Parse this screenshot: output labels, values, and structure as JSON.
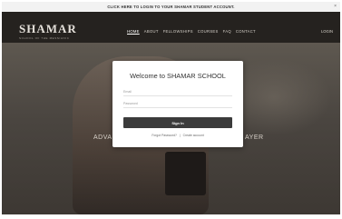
{
  "announcement": {
    "text": "CLICK HERE TO LOGIN TO YOUR SHAMAR STUDENT ACCOUNT.",
    "close": "×"
  },
  "header": {
    "logo": "SHAMAR",
    "tagline": "SCHOOL OF THE MESSIANIC",
    "nav": [
      "HOME",
      "ABOUT",
      "FELLOWSHIPS",
      "COURSES",
      "FAQ",
      "CONTACT"
    ],
    "login": "LOGIN"
  },
  "hero": {
    "left_text": "ADVA",
    "right_text": "AYER"
  },
  "modal": {
    "title": "Welcome to SHAMAR SCHOOL",
    "email_placeholder": "Email",
    "password_placeholder": "Password",
    "signin_label": "Sign In",
    "forgot_label": "Forgot Password?",
    "separator": "|",
    "create_label": "Create account"
  },
  "colors": {
    "header_bg": "#25221f",
    "button_bg": "#3b3b3b",
    "announce_bg": "#f2f2f2"
  }
}
